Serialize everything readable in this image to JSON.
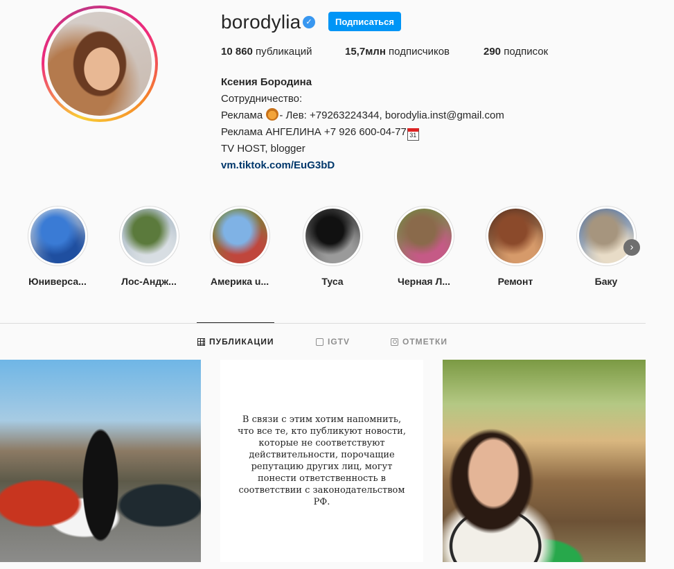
{
  "profile": {
    "username": "borodylia",
    "follow_label": "Подписаться",
    "stats": {
      "posts_count": "10 860",
      "posts_label": " публикаций",
      "followers_count": "15,7млн",
      "followers_label": " подписчиков",
      "following_count": "290",
      "following_label": " подписок"
    },
    "bio": {
      "full_name": "Ксения Бородина",
      "line1": "Сотрудничество:",
      "line2_prefix": "Реклама ",
      "line2_suffix": "- Лев: +79263224344, borodylia.inst@gmail.com",
      "line3": "Реклама АНГЕЛИНА +7 926 600-04-77",
      "calendar_day": "31",
      "line4": "TV HOST, blogger",
      "link": "vm.tiktok.com/EuG3bD"
    }
  },
  "highlights": [
    {
      "label": "Юниверса...",
      "colors": [
        "#3a7bd5",
        "#1f4fa0",
        "#c9d6e3"
      ]
    },
    {
      "label": "Лос-Андж...",
      "colors": [
        "#5b7a3c",
        "#d8dee3",
        "#a8b8c4"
      ]
    },
    {
      "label": "Америка u...",
      "colors": [
        "#7fb2e5",
        "#c0463c",
        "#6d8f3b"
      ]
    },
    {
      "label": "Туса",
      "colors": [
        "#111111",
        "#9a9a9a",
        "#2b2b2b"
      ]
    },
    {
      "label": "Черная Л...",
      "colors": [
        "#8a6a4b",
        "#c55a86",
        "#6b8f3e"
      ]
    },
    {
      "label": "Ремонт",
      "colors": [
        "#8b4a2b",
        "#d69a6a",
        "#4d2a1b"
      ]
    },
    {
      "label": "Баку",
      "colors": [
        "#a6957e",
        "#e8dcc7",
        "#4a6fa5"
      ]
    }
  ],
  "tabs": [
    {
      "label": "ПУБЛИКАЦИИ",
      "icon": "grid-icon",
      "active": true
    },
    {
      "label": "IGTV",
      "icon": "igtv-icon",
      "active": false
    },
    {
      "label": "ОТМЕТКИ",
      "icon": "tagged-icon",
      "active": false
    }
  ],
  "posts": {
    "text_post": "В связи с этим хотим напомнить, что все те, кто публикуют новости, которые не соответствуют действительности, порочащие репутацию других лиц, могут понести ответственность в соответствии с законодательством РФ."
  },
  "colors": {
    "accent": "#0095f6",
    "verified": "#3897f0",
    "link": "#00376b"
  }
}
